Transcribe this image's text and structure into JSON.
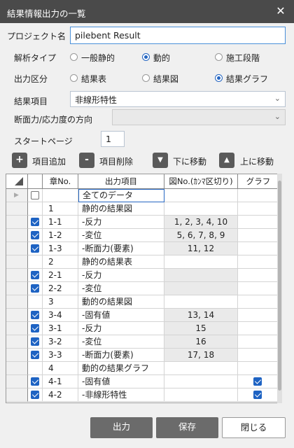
{
  "window": {
    "title": "結果情報出力の一覧",
    "close_glyph": "✕"
  },
  "project": {
    "label": "プロジェクト名",
    "value": "pilebent Result"
  },
  "analysis": {
    "label": "解析タイプ",
    "options": [
      "一般静的",
      "動的",
      "施工段階"
    ],
    "selected": "動的"
  },
  "output": {
    "label": "出力区分",
    "options": [
      "結果表",
      "結果図",
      "結果グラフ"
    ],
    "selected": "結果グラフ"
  },
  "result_item": {
    "label": "結果項目",
    "value": "非線形特性"
  },
  "direction": {
    "label": "断面力/応力度の方向",
    "value": ""
  },
  "start_page": {
    "label": "スタートページ",
    "value": "1"
  },
  "toolbar": {
    "add": {
      "icon": "+",
      "label": "項目追加"
    },
    "del": {
      "icon": "-",
      "label": "項目削除"
    },
    "down": {
      "icon": "▼",
      "label": "下に移動"
    },
    "up": {
      "icon": "▲",
      "label": "上に移動"
    }
  },
  "grid": {
    "headers": [
      "章No.",
      "出力項目",
      "図No.(ｶﾝﾏ区切り)",
      "グラフ"
    ],
    "rows": [
      {
        "check": false,
        "chapter": "",
        "item": "全てのデータ",
        "fig": "",
        "graph": false,
        "shade": false
      },
      {
        "check": null,
        "chapter": "1",
        "item": "静的の結果図",
        "fig": "",
        "graph": false,
        "shade": false
      },
      {
        "check": true,
        "chapter": "1-1",
        "item": "-反力",
        "fig": "1, 2, 3, 4, 10",
        "graph": false,
        "shade": true
      },
      {
        "check": true,
        "chapter": "1-2",
        "item": "-変位",
        "fig": "5, 6, 7, 8, 9",
        "graph": false,
        "shade": true
      },
      {
        "check": true,
        "chapter": "1-3",
        "item": "-断面力(要素)",
        "fig": "11, 12",
        "graph": false,
        "shade": true
      },
      {
        "check": null,
        "chapter": "2",
        "item": "静的の結果表",
        "fig": "",
        "graph": false,
        "shade": false
      },
      {
        "check": true,
        "chapter": "2-1",
        "item": "-反力",
        "fig": "",
        "graph": false,
        "shade": true
      },
      {
        "check": true,
        "chapter": "2-2",
        "item": "-変位",
        "fig": "",
        "graph": false,
        "shade": true
      },
      {
        "check": null,
        "chapter": "3",
        "item": "動的の結果図",
        "fig": "",
        "graph": false,
        "shade": false
      },
      {
        "check": true,
        "chapter": "3-4",
        "item": "-固有値",
        "fig": "13, 14",
        "graph": false,
        "shade": true
      },
      {
        "check": true,
        "chapter": "3-1",
        "item": "-反力",
        "fig": "15",
        "graph": false,
        "shade": true
      },
      {
        "check": true,
        "chapter": "3-2",
        "item": "-変位",
        "fig": "16",
        "graph": false,
        "shade": true
      },
      {
        "check": true,
        "chapter": "3-3",
        "item": "-断面力(要素)",
        "fig": "17, 18",
        "graph": false,
        "shade": true
      },
      {
        "check": null,
        "chapter": "4",
        "item": "動的の結果グラフ",
        "fig": "",
        "graph": false,
        "shade": false
      },
      {
        "check": true,
        "chapter": "4-1",
        "item": "-固有値",
        "fig": "",
        "graph": true,
        "shade": false
      },
      {
        "check": true,
        "chapter": "4-2",
        "item": "-非線形特性",
        "fig": "",
        "graph": true,
        "shade": false
      }
    ]
  },
  "buttons": {
    "output": "出力",
    "save": "保存",
    "close": "閉じる"
  }
}
